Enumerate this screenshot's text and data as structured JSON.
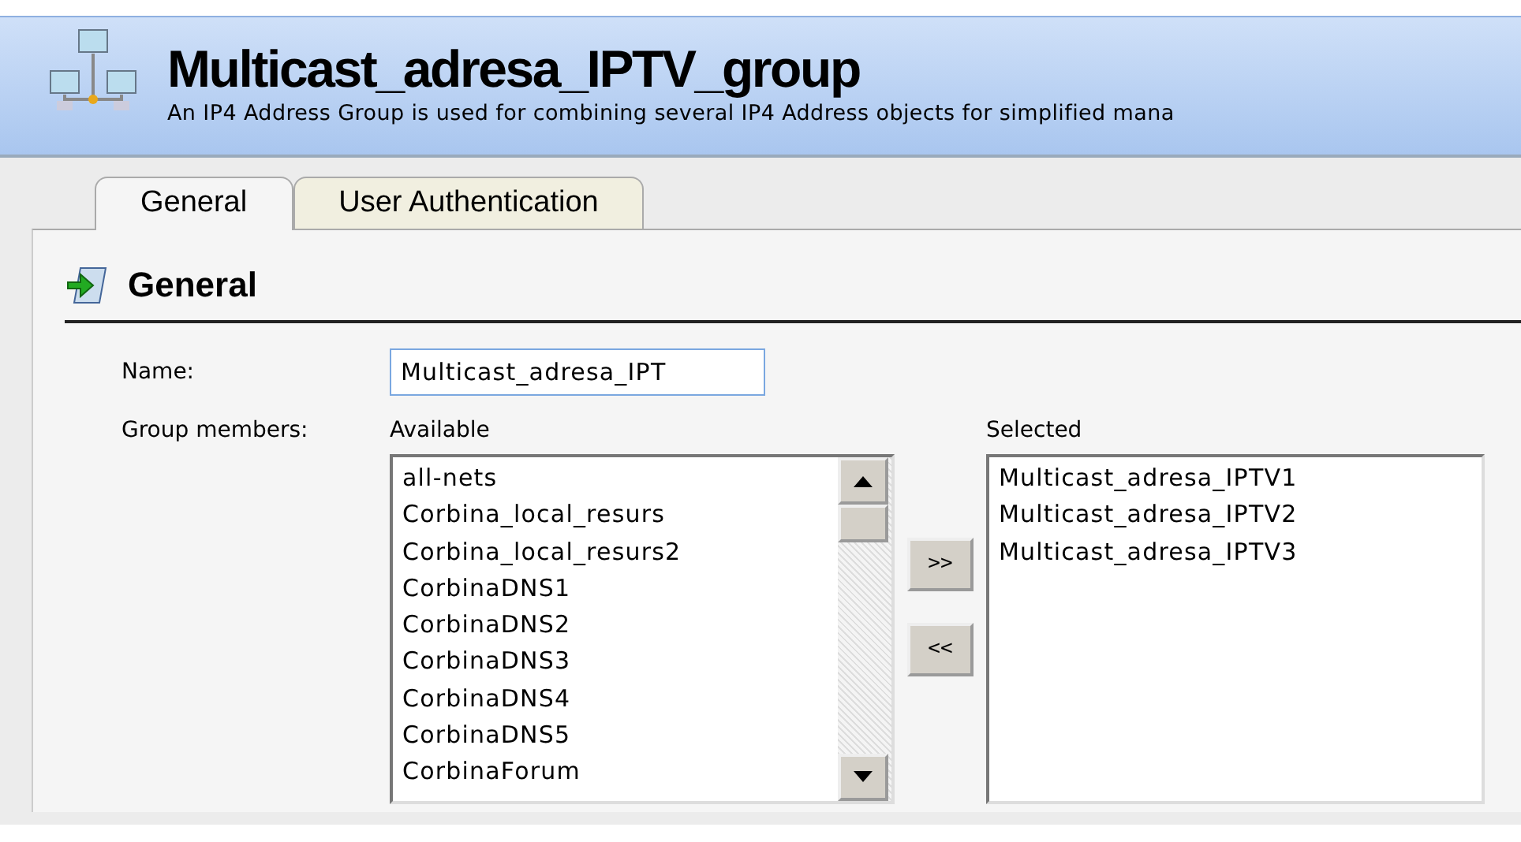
{
  "header": {
    "title": "Multicast_adresa_IPTV_group",
    "description": "An IP4 Address Group is used for combining several IP4 Address objects for simplified mana"
  },
  "tabs": [
    {
      "label": "General",
      "selected": true
    },
    {
      "label": "User Authentication",
      "selected": false
    }
  ],
  "section": {
    "title": "General"
  },
  "form": {
    "name_label": "Name:",
    "name_value": "Multicast_adresa_IPT",
    "members_label": "Group members:",
    "available": {
      "label": "Available",
      "items": [
        "all-nets",
        "Corbina_local_resurs",
        "Corbina_local_resurs2",
        "CorbinaDNS1",
        "CorbinaDNS2",
        "CorbinaDNS3",
        "CorbinaDNS4",
        "CorbinaDNS5",
        "CorbinaForum"
      ]
    },
    "buttons": [
      ">>",
      "<<"
    ],
    "selected": {
      "label": "Selected",
      "items": [
        "Multicast_adresa_IPTV1",
        "Multicast_adresa_IPTV2",
        "Multicast_adresa_IPTV3"
      ]
    }
  }
}
